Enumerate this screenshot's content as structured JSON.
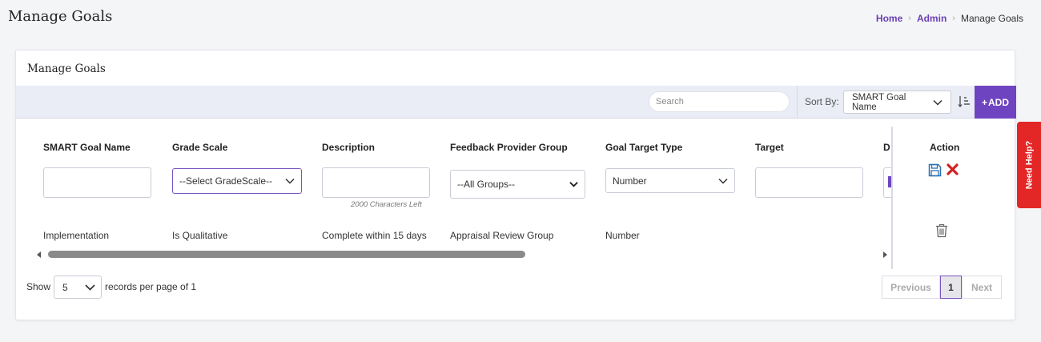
{
  "page": {
    "title": "Manage Goals"
  },
  "breadcrumb": {
    "home": "Home",
    "admin": "Admin",
    "current": "Manage Goals"
  },
  "card": {
    "title": "Manage Goals"
  },
  "toolbar": {
    "search_placeholder": "Search",
    "sort_label": "Sort By:",
    "sort_value": "SMART Goal Name",
    "add_label": "ADD",
    "add_prefix": "+"
  },
  "table": {
    "columns": [
      "SMART Goal Name",
      "Grade Scale",
      "Description",
      "Feedback Provider Group",
      "Goal Target Type",
      "Target",
      "D"
    ],
    "action_header": "Action",
    "edit_row": {
      "grade_scale_placeholder": "--Select GradeScale--",
      "description_chars_left": "2000 Characters Left",
      "feedback_group_value": "--All Groups--",
      "target_type_value": "Number"
    },
    "rows": [
      {
        "smart_goal_name": "Implementation",
        "grade_scale": "Is Qualitative",
        "description": "Complete within 15 days",
        "feedback_provider_group": "Appraisal Review Group",
        "goal_target_type": "Number"
      }
    ]
  },
  "footer": {
    "show_label": "Show",
    "per_page_value": "5",
    "records_label": "records per page of 1",
    "pagination": {
      "previous": "Previous",
      "current_page": "1",
      "next": "Next"
    }
  },
  "help_tab": {
    "label": "Need Help?"
  },
  "colors": {
    "accent": "#6f44c0",
    "help": "#e32626",
    "save": "#2a6fb0",
    "cancel": "#d42020"
  }
}
